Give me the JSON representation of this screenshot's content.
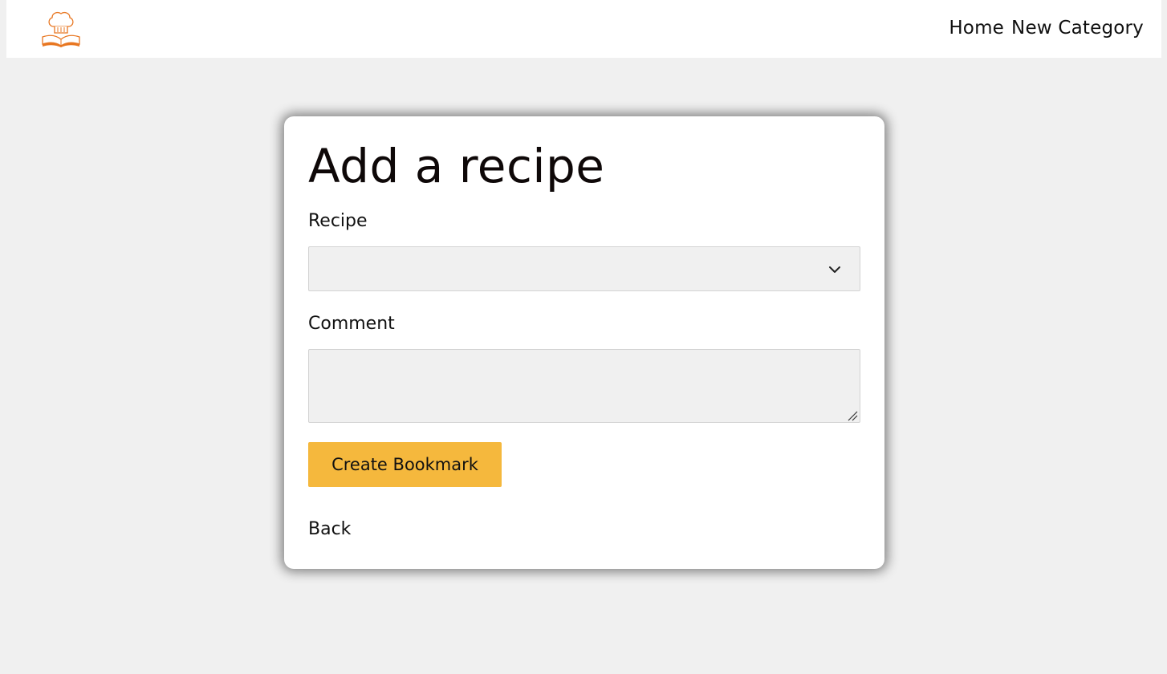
{
  "navbar": {
    "logo_icon": "chef-hat-book-icon",
    "links": [
      {
        "label": "Home"
      },
      {
        "label": "New Category"
      }
    ]
  },
  "form": {
    "title": "Add a recipe",
    "recipe_label": "Recipe",
    "recipe_selected": "",
    "comment_label": "Comment",
    "comment_value": "",
    "submit_label": "Create Bookmark",
    "back_label": "Back"
  },
  "colors": {
    "page_background": "#f0f0f0",
    "button_accent": "#f5b83d",
    "logo_orange": "#e87722"
  }
}
